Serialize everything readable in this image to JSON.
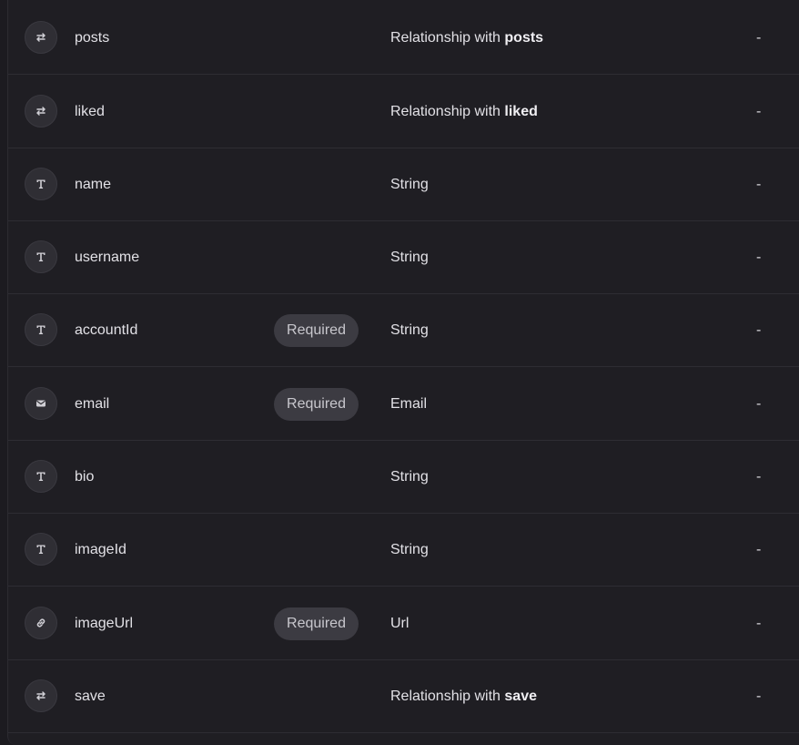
{
  "fields": [
    {
      "name": "posts",
      "icon": "relationship-icon",
      "required": false,
      "type_prefix": "Relationship with ",
      "type_bold": "posts",
      "type": "",
      "default": "-"
    },
    {
      "name": "liked",
      "icon": "relationship-icon",
      "required": false,
      "type_prefix": "Relationship with ",
      "type_bold": "liked",
      "type": "",
      "default": "-"
    },
    {
      "name": "name",
      "icon": "text-icon",
      "required": false,
      "type_prefix": "",
      "type_bold": "",
      "type": "String",
      "default": "-"
    },
    {
      "name": "username",
      "icon": "text-icon",
      "required": false,
      "type_prefix": "",
      "type_bold": "",
      "type": "String",
      "default": "-"
    },
    {
      "name": "accountId",
      "icon": "text-icon",
      "required": true,
      "type_prefix": "",
      "type_bold": "",
      "type": "String",
      "default": "-"
    },
    {
      "name": "email",
      "icon": "email-icon",
      "required": true,
      "type_prefix": "",
      "type_bold": "",
      "type": "Email",
      "default": "-"
    },
    {
      "name": "bio",
      "icon": "text-icon",
      "required": false,
      "type_prefix": "",
      "type_bold": "",
      "type": "String",
      "default": "-"
    },
    {
      "name": "imageId",
      "icon": "text-icon",
      "required": false,
      "type_prefix": "",
      "type_bold": "",
      "type": "String",
      "default": "-"
    },
    {
      "name": "imageUrl",
      "icon": "link-icon",
      "required": true,
      "type_prefix": "",
      "type_bold": "",
      "type": "Url",
      "default": "-"
    },
    {
      "name": "save",
      "icon": "relationship-icon",
      "required": false,
      "type_prefix": "Relationship with ",
      "type_bold": "save",
      "type": "",
      "default": "-"
    }
  ],
  "required_label": "Required",
  "colors": {
    "background": "#1c1b20",
    "panel": "#1f1e23",
    "badge": "#3c3b42",
    "text": "#e2e1e6"
  }
}
